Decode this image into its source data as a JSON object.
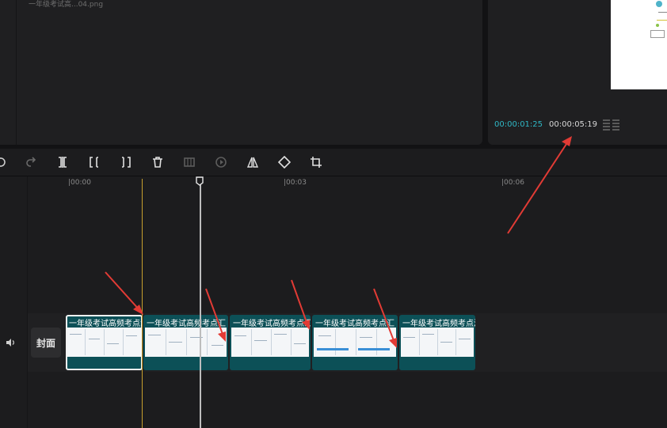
{
  "media": {
    "file_name": "一年级考试高...04.png"
  },
  "preview": {
    "current_time": "00:00:01:25",
    "total_time": "00:00:05:19",
    "current_time_color": "#2fb7c5"
  },
  "toolbar": {
    "tools": [
      "undo-icon",
      "redo-icon",
      "split-icon",
      "trim-left-icon",
      "trim-right-icon",
      "delete-icon",
      "freeze-frame-icon",
      "reverse-icon",
      "mirror-icon",
      "rotate-icon",
      "crop-icon"
    ]
  },
  "ruler": {
    "ticks": [
      "|00:00",
      "|00:03",
      "|00:06"
    ]
  },
  "track": {
    "cover_label": "封面",
    "clips": [
      {
        "title": "一年级考试高频考点汇"
      },
      {
        "title": "一年级考试高频考点汇"
      },
      {
        "title": "一年级考试高频考点汇"
      },
      {
        "title": "一年级考试高频考点汇"
      },
      {
        "title": "一年级考试高频考点汇"
      }
    ],
    "clip_color": "#0c5057"
  },
  "annotation_color": "#e23b35"
}
